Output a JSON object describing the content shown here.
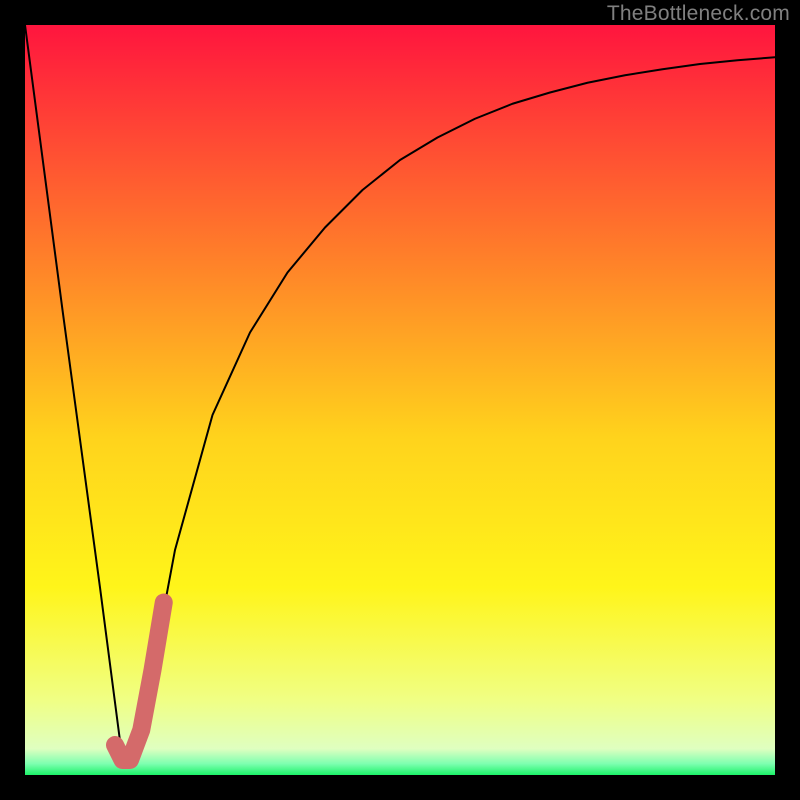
{
  "watermark": "TheBottleneck.com",
  "colors": {
    "frame": "#000000",
    "gradient_top": "#ff153e",
    "gradient_mid_upper": "#ff7c2a",
    "gradient_mid": "#ffd31c",
    "gradient_mid_lower": "#fff51a",
    "gradient_lower": "#f0ff84",
    "gradient_bottom": "#1cf269",
    "curve_main": "#000000",
    "curve_accent": "#d46a6a"
  },
  "chart_data": {
    "type": "line",
    "title": "",
    "xlabel": "",
    "ylabel": "",
    "x_range": [
      0,
      100
    ],
    "y_range": [
      0,
      100
    ],
    "series": [
      {
        "name": "bottleneck-curve",
        "color": "#000000",
        "x": [
          0,
          5,
          10,
          13,
          15,
          17,
          20,
          25,
          30,
          35,
          40,
          45,
          50,
          55,
          60,
          65,
          70,
          75,
          80,
          85,
          90,
          95,
          100
        ],
        "y": [
          100,
          62,
          25,
          2,
          2,
          14,
          30,
          48,
          59,
          67,
          73,
          78,
          82,
          85,
          87.5,
          89.5,
          91,
          92.3,
          93.3,
          94.1,
          94.8,
          95.3,
          95.7
        ]
      },
      {
        "name": "highlight-segment",
        "color": "#d46a6a",
        "x": [
          12,
          13,
          14,
          15.5,
          17,
          18.5
        ],
        "y": [
          4,
          2,
          2,
          6,
          14,
          23
        ]
      }
    ],
    "gradient_stops": [
      {
        "offset": 0.0,
        "color": "#ff153e"
      },
      {
        "offset": 0.3,
        "color": "#ff7c2a"
      },
      {
        "offset": 0.55,
        "color": "#ffd31c"
      },
      {
        "offset": 0.75,
        "color": "#fff51a"
      },
      {
        "offset": 0.9,
        "color": "#f0ff84"
      },
      {
        "offset": 0.965,
        "color": "#dfffc0"
      },
      {
        "offset": 0.985,
        "color": "#7dffb0"
      },
      {
        "offset": 1.0,
        "color": "#1cf269"
      }
    ]
  }
}
